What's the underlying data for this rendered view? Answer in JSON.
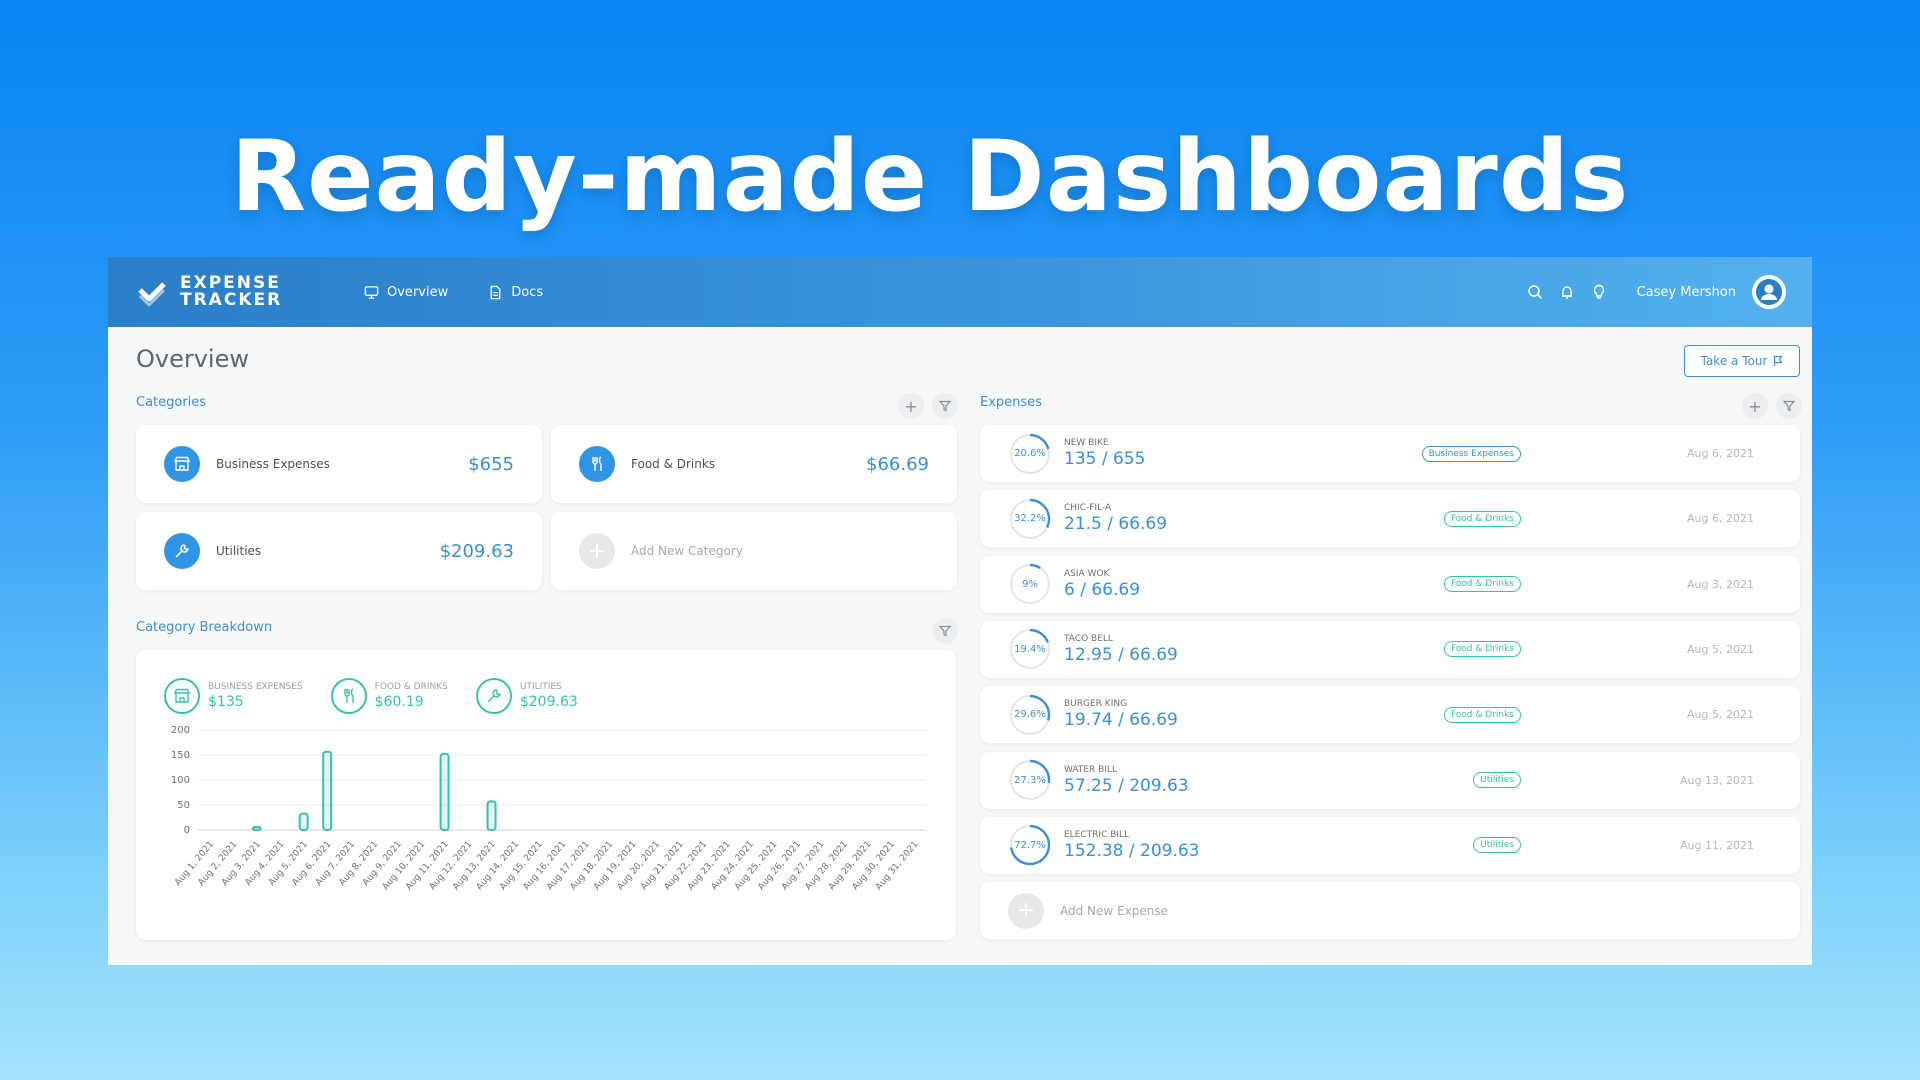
{
  "headline": "Ready-made Dashboards",
  "app": {
    "brand": {
      "line1": "EXPENSE",
      "line2": "TRACKER"
    },
    "nav": [
      {
        "label": "Overview",
        "icon": "monitor-icon"
      },
      {
        "label": "Docs",
        "icon": "document-icon"
      }
    ],
    "topbar_icons": [
      "search-icon",
      "bell-icon",
      "lightbulb-icon"
    ],
    "user": {
      "name": "Casey Mershon",
      "icon": "user-avatar-icon"
    },
    "page_title": "Overview",
    "tour_button": "Take a Tour",
    "categories": {
      "label": "Categories",
      "items": [
        {
          "name": "Business Expenses",
          "amount": "$655",
          "icon": "store-icon"
        },
        {
          "name": "Food & Drinks",
          "amount": "$66.69",
          "icon": "utensils-icon"
        },
        {
          "name": "Utilities",
          "amount": "$209.63",
          "icon": "wrench-icon"
        }
      ],
      "add_label": "Add New Category"
    },
    "breakdown": {
      "label": "Category Breakdown",
      "legend": [
        {
          "label": "BUSINESS EXPENSES",
          "value": "$135",
          "icon": "store-icon"
        },
        {
          "label": "FOOD & DRINKS",
          "value": "$60.19",
          "icon": "utensils-icon"
        },
        {
          "label": "UTILITIES",
          "value": "$209.63",
          "icon": "wrench-icon"
        }
      ]
    },
    "expenses": {
      "label": "Expenses",
      "items": [
        {
          "name": "NEW BIKE",
          "amount": "135 / 655",
          "percent": "20.6%",
          "fraction": 0.206,
          "category": "Business Expenses",
          "date": "Aug 6, 2021"
        },
        {
          "name": "CHIC-FIL-A",
          "amount": "21.5 / 66.69",
          "percent": "32.2%",
          "fraction": 0.322,
          "category": "Food & Drinks",
          "date": "Aug 6, 2021"
        },
        {
          "name": "ASIA WOK",
          "amount": "6 / 66.69",
          "percent": "9%",
          "fraction": 0.09,
          "category": "Food & Drinks",
          "date": "Aug 3, 2021"
        },
        {
          "name": "TACO BELL",
          "amount": "12.95 / 66.69",
          "percent": "19.4%",
          "fraction": 0.194,
          "category": "Food & Drinks",
          "date": "Aug 5, 2021"
        },
        {
          "name": "BURGER KING",
          "amount": "19.74 / 66.69",
          "percent": "29.6%",
          "fraction": 0.296,
          "category": "Food & Drinks",
          "date": "Aug 5, 2021"
        },
        {
          "name": "WATER BILL",
          "amount": "57.25 / 209.63",
          "percent": "27.3%",
          "fraction": 0.273,
          "category": "Utilities",
          "date": "Aug 13, 2021"
        },
        {
          "name": "ELECTRIC BILL",
          "amount": "152.38 / 209.63",
          "percent": "72.7%",
          "fraction": 0.727,
          "category": "Utilities",
          "date": "Aug 11, 2021"
        }
      ],
      "add_label": "Add New Expense"
    }
  },
  "colors": {
    "accent": "#3b8fd9",
    "teal": "#38c1a8",
    "business_badge": "#3b8fd9",
    "food_badge": "#38c1a8",
    "utilities_badge": "#38c1a8"
  },
  "chart_data": {
    "type": "bar",
    "categories": [
      "Aug 1, 2021",
      "Aug 2, 2021",
      "Aug 3, 2021",
      "Aug 4, 2021",
      "Aug 5, 2021",
      "Aug 6, 2021",
      "Aug 7, 2021",
      "Aug 8, 2021",
      "Aug 9, 2021",
      "Aug 10, 2021",
      "Aug 11, 2021",
      "Aug 12, 2021",
      "Aug 13, 2021",
      "Aug 14, 2021",
      "Aug 15, 2021",
      "Aug 16, 2021",
      "Aug 17, 2021",
      "Aug 18, 2021",
      "Aug 19, 2021",
      "Aug 20, 2021",
      "Aug 21, 2021",
      "Aug 22, 2021",
      "Aug 23, 2021",
      "Aug 24, 2021",
      "Aug 25, 2021",
      "Aug 26, 2021",
      "Aug 27, 2021",
      "Aug 28, 2021",
      "Aug 29, 2021",
      "Aug 30, 2021",
      "Aug 31, 2021"
    ],
    "values": [
      0,
      0,
      6,
      0,
      32.7,
      156.5,
      0,
      0,
      0,
      0,
      152.4,
      0,
      57.3,
      0,
      0,
      0,
      0,
      0,
      0,
      0,
      0,
      0,
      0,
      0,
      0,
      0,
      0,
      0,
      0,
      0,
      0
    ],
    "yticks": [
      0,
      50,
      100,
      150,
      200
    ],
    "ylim": [
      0,
      200
    ],
    "grid": true
  }
}
